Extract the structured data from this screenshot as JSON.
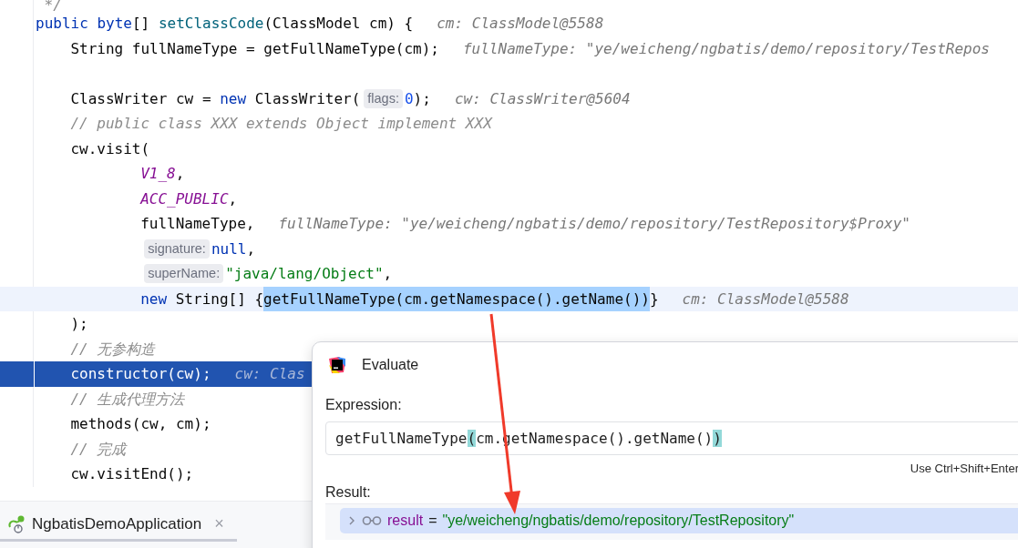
{
  "editor": {
    "lines": [
      {
        "tokens": [
          {
            "text": "*/",
            "kind": "comment"
          }
        ]
      },
      {
        "tokens": [
          {
            "text": "public byte",
            "kind": "keyword"
          },
          {
            "text": "[] ",
            "kind": "plain"
          },
          {
            "text": "setClassCode",
            "kind": "declaration"
          },
          {
            "text": "(ClassModel cm) {",
            "kind": "plain"
          }
        ],
        "debug": "cm: ClassModel@5588",
        "children": [
          {
            "tokens": [
              {
                "text": "String fullNameType = getFullNameType(cm);",
                "kind": "plain"
              }
            ],
            "debug": "fullNameType: \"ye/weicheng/ngbatis/demo/repository/TestRepos"
          },
          {
            "kind": "blank"
          },
          {
            "tokens": [
              {
                "text": "ClassWriter cw = ",
                "kind": "plain"
              },
              {
                "text": "new",
                "kind": "keyword"
              },
              {
                "text": " ClassWriter(",
                "kind": "plain"
              },
              {
                "text": "flags:",
                "kind": "hint"
              },
              {
                "text": "0",
                "kind": "number"
              },
              {
                "text": ");",
                "kind": "plain"
              }
            ],
            "debug": "cw: ClassWriter@5604"
          },
          {
            "tokens": [
              {
                "text": "// public class XXX extends Object implement XXX",
                "kind": "comment"
              }
            ]
          },
          {
            "tokens": [
              {
                "text": "cw.visit(",
                "kind": "plain"
              }
            ],
            "children": [
              {
                "tokens": [
                  {
                    "text": "V1_8",
                    "kind": "constant"
                  },
                  {
                    "text": ",",
                    "kind": "plain"
                  }
                ]
              },
              {
                "tokens": [
                  {
                    "text": "ACC_PUBLIC",
                    "kind": "constant"
                  },
                  {
                    "text": ",",
                    "kind": "plain"
                  }
                ]
              },
              {
                "tokens": [
                  {
                    "text": "fullNameType,",
                    "kind": "plain"
                  }
                ],
                "debug": "fullNameType: \"ye/weicheng/ngbatis/demo/repository/TestRepository$Proxy\""
              },
              {
                "tokens": [
                  {
                    "text": "signature:",
                    "kind": "hint"
                  },
                  {
                    "text": "null",
                    "kind": "keyword"
                  },
                  {
                    "text": ",",
                    "kind": "plain"
                  }
                ]
              },
              {
                "tokens": [
                  {
                    "text": "superName:",
                    "kind": "hint"
                  },
                  {
                    "text": "\"java/lang/Object\"",
                    "kind": "string"
                  },
                  {
                    "text": ",",
                    "kind": "plain"
                  }
                ]
              },
              {
                "kind": "caret",
                "tokens": [
                  {
                    "text": "new",
                    "kind": "keyword"
                  },
                  {
                    "text": " String[] {",
                    "kind": "plain"
                  },
                  {
                    "text": "getFullNameType(cm.getNamespace().getName())",
                    "kind": "selection"
                  },
                  {
                    "text": "}",
                    "kind": "plain"
                  }
                ],
                "debug": "cm: ClassModel@5588"
              }
            ]
          },
          {
            "tokens": [
              {
                "text": ");",
                "kind": "plain"
              }
            ]
          },
          {
            "tokens": [
              {
                "text": "// 无参构造",
                "kind": "comment"
              }
            ]
          },
          {
            "kind": "execution",
            "tokens": [
              {
                "text": "constructor(cw);",
                "kind": "plain"
              }
            ],
            "debug": "cw: Clas"
          },
          {
            "tokens": [
              {
                "text": "// 生成代理方法",
                "kind": "comment"
              }
            ]
          },
          {
            "tokens": [
              {
                "text": "methods(cw, cm);",
                "kind": "plain"
              }
            ]
          },
          {
            "tokens": [
              {
                "text": "// 完成",
                "kind": "comment"
              }
            ]
          },
          {
            "tokens": [
              {
                "text": "cw.visitEnd();",
                "kind": "plain"
              }
            ]
          }
        ]
      }
    ]
  },
  "run_tab": {
    "label": "NgbatisDemoApplication",
    "close": "×"
  },
  "evaluate_dialog": {
    "title": "Evaluate",
    "expression_label": "Expression:",
    "expression": [
      {
        "text": "getFullNameType",
        "kind": "plain"
      },
      {
        "text": "(",
        "kind": "match"
      },
      {
        "text": "cm.getNamespace().getName()",
        "kind": "plain"
      },
      {
        "text": ")",
        "kind": "match"
      }
    ],
    "shortcut_hint": "Use Ctrl+Shift+Enter",
    "result_label": "Result:",
    "result": {
      "name": "result",
      "equals": "=",
      "value": "\"ye/weicheng/ngbatis/demo/repository/TestRepository\"",
      "expanded": false,
      "selected": true
    }
  }
}
